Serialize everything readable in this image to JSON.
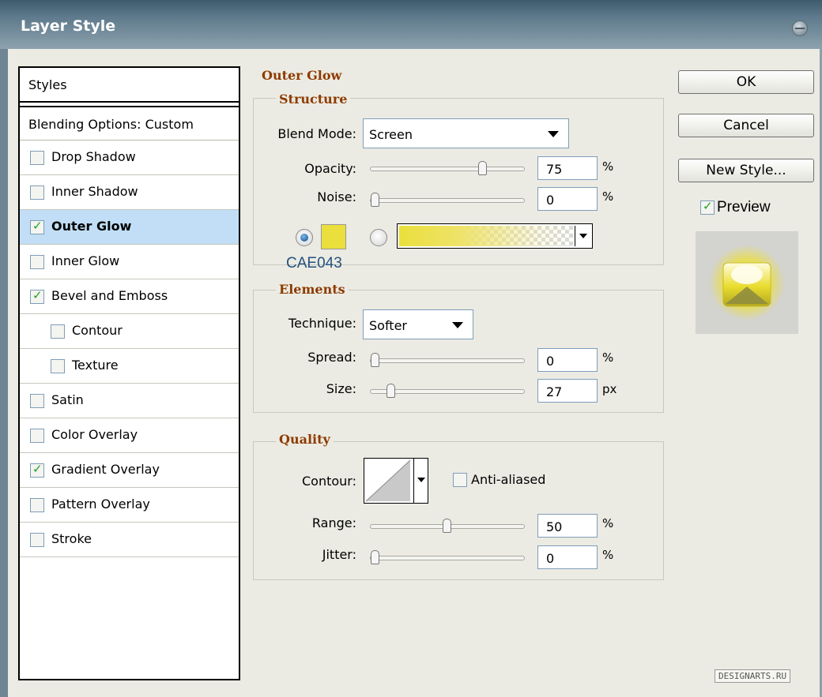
{
  "window": {
    "title": "Layer Style"
  },
  "styles_list": {
    "header": "Styles",
    "blending_options": "Blending Options: Custom",
    "items": [
      {
        "label": "Drop Shadow",
        "checked": false,
        "selected": false,
        "indent": false
      },
      {
        "label": "Inner Shadow",
        "checked": false,
        "selected": false,
        "indent": false
      },
      {
        "label": "Outer Glow",
        "checked": true,
        "selected": true,
        "indent": false
      },
      {
        "label": "Inner Glow",
        "checked": false,
        "selected": false,
        "indent": false
      },
      {
        "label": "Bevel and Emboss",
        "checked": true,
        "selected": false,
        "indent": false
      },
      {
        "label": "Contour",
        "checked": false,
        "selected": false,
        "indent": true
      },
      {
        "label": "Texture",
        "checked": false,
        "selected": false,
        "indent": true
      },
      {
        "label": "Satin",
        "checked": false,
        "selected": false,
        "indent": false
      },
      {
        "label": "Color Overlay",
        "checked": false,
        "selected": false,
        "indent": false
      },
      {
        "label": "Gradient Overlay",
        "checked": true,
        "selected": false,
        "indent": false
      },
      {
        "label": "Pattern Overlay",
        "checked": false,
        "selected": false,
        "indent": false
      },
      {
        "label": "Stroke",
        "checked": false,
        "selected": false,
        "indent": false
      }
    ]
  },
  "outer_glow": {
    "title": "Outer Glow",
    "structure": {
      "title": "Structure",
      "blend_mode_label": "Blend Mode:",
      "blend_mode_value": "Screen",
      "opacity_label": "Opacity:",
      "opacity_value": "75",
      "opacity_unit": "%",
      "opacity_level": 0.75,
      "noise_label": "Noise:",
      "noise_value": "0",
      "noise_unit": "%",
      "noise_level": 0,
      "color_mode": "solid",
      "glow_color": "#eadf3c",
      "color_caption": "CAE043"
    },
    "elements": {
      "title": "Elements",
      "technique_label": "Technique:",
      "technique_value": "Softer",
      "spread_label": "Spread:",
      "spread_value": "0",
      "spread_unit": "%",
      "spread_level": 0,
      "size_label": "Size:",
      "size_value": "27",
      "size_unit": "px",
      "size_level": 0.11
    },
    "quality": {
      "title": "Quality",
      "contour_label": "Contour:",
      "anti_aliased_label": "Anti-aliased",
      "anti_aliased_checked": false,
      "range_label": "Range:",
      "range_value": "50",
      "range_unit": "%",
      "range_level": 0.5,
      "jitter_label": "Jitter:",
      "jitter_value": "0",
      "jitter_unit": "%",
      "jitter_level": 0
    }
  },
  "buttons": {
    "ok": "OK",
    "cancel": "Cancel",
    "new_style": "New Style...",
    "preview_label": "Preview",
    "preview_checked": true
  },
  "watermark": "DESIGNARTS.RU"
}
